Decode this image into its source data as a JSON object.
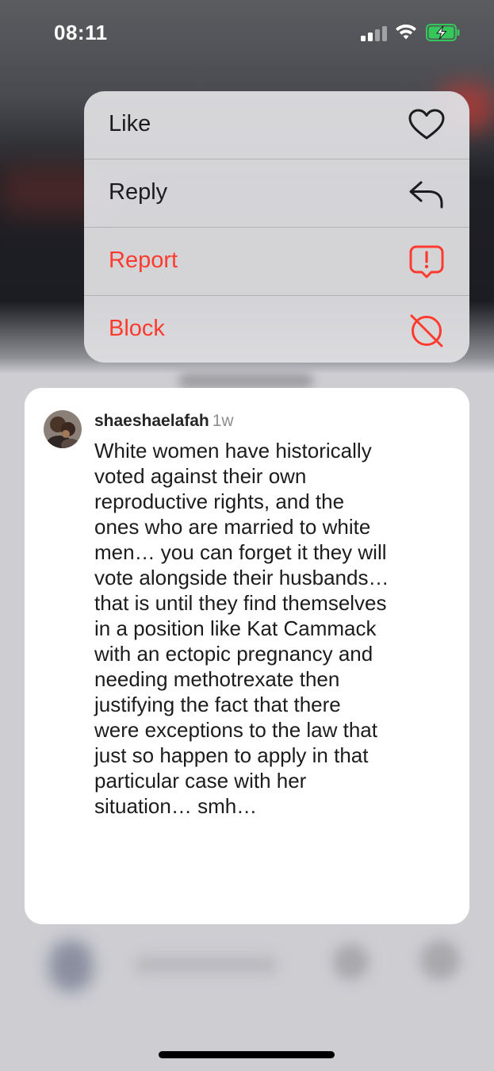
{
  "status_bar": {
    "time": "08:11",
    "icons": [
      "cellular-signal-icon",
      "wifi-icon",
      "battery-charging-icon"
    ],
    "battery_color": "#34c759"
  },
  "context_menu": {
    "items": [
      {
        "label": "Like",
        "icon": "heart-icon",
        "destructive": false
      },
      {
        "label": "Reply",
        "icon": "reply-arrow-icon",
        "destructive": false
      },
      {
        "label": "Report",
        "icon": "report-exclamation-icon",
        "destructive": true
      },
      {
        "label": "Block",
        "icon": "block-icon",
        "destructive": true
      }
    ],
    "destructive_color": "#ff3b30"
  },
  "comment": {
    "username": "shaeshaelafah",
    "age": "1w",
    "text": "White women have historically voted against their own reproductive rights, and the ones who are married to white men… you can forget it they will vote alongside their husbands… that is until they find themselves in a position like Kat Cammack with an ectopic pregnancy and needing methotrexate then justifying the fact that there were exceptions to the law that just so happen to apply in that particular case with her situation… smh…"
  }
}
